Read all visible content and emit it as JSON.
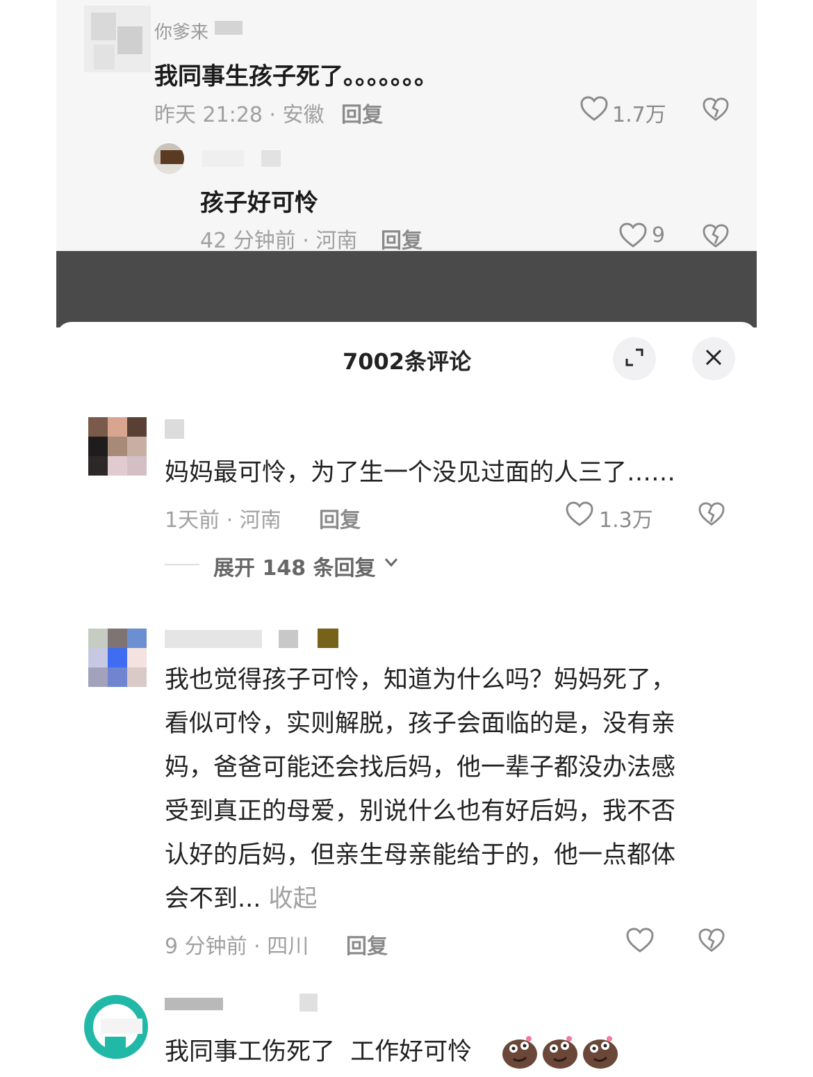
{
  "top_thread": {
    "comment": {
      "username": "你爹来",
      "text": "我同事生孩子死了。。。。。。。",
      "time_location": "昨天 21:28 · 安徽",
      "reply_label": "回复",
      "likes": "1.7万"
    },
    "sub_reply": {
      "text": "孩子好可怜",
      "time_location": "42 分钟前 · 河南",
      "reply_label": "回复",
      "likes": "9"
    }
  },
  "panel": {
    "title": "7002条评论",
    "comments": [
      {
        "text": "妈妈最可怜，为了生一个没见过面的人三了……",
        "time_location": "1天前 · 河南",
        "reply_label": "回复",
        "likes": "1.3万",
        "expand_label": "展开 148 条回复"
      },
      {
        "text_lines": [
          "我也觉得孩子可怜，知道为什么吗？妈妈死了，",
          "看似可怜，实则解脱，孩子会面临的是，没有亲",
          "妈，爸爸可能还会找后妈，他一辈子都没办法感",
          "受到真正的母爱，别说什么也有好后妈，我不否",
          "认好的后妈，但亲生母亲能给于的，他一点都体",
          "会不到..."
        ],
        "collapse_label": "收起",
        "time_location": "9 分钟前 · 四川",
        "reply_label": "回复"
      },
      {
        "text": "我同事工伤死了  工作好可怜"
      }
    ]
  },
  "colors": {
    "dark_band": "#4a4a4a",
    "muted_text": "#a0a0a0",
    "main_text": "#1a1a1a"
  },
  "icons": [
    "heart-icon",
    "dislike-heart-icon",
    "expand-icon",
    "close-icon",
    "chevron-down-icon",
    "emoji-face-icon"
  ]
}
